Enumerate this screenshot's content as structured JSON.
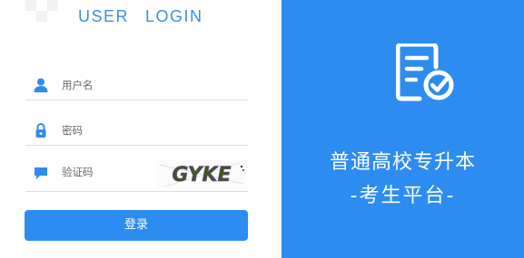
{
  "login": {
    "heading_word1": "USER",
    "heading_word2": "LOGIN",
    "username_placeholder": "用户名",
    "password_placeholder": "密码",
    "captcha_placeholder": "验证码",
    "captcha_text": "GYKE",
    "submit_label": "登录"
  },
  "platform": {
    "title_line1": "普通高校专升本",
    "title_line2": "-考生平台-"
  },
  "colors": {
    "accent": "#2d8cf0",
    "heading": "#3c8fe6",
    "field_underline": "#cfe3e8"
  },
  "icons": {
    "username": "user-icon",
    "password": "lock-icon",
    "captcha": "chat-bubble-icon",
    "platform": "document-check-icon"
  }
}
